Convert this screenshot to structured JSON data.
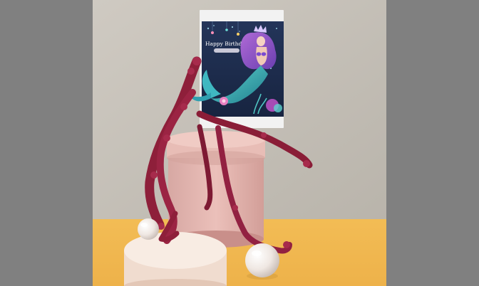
{
  "image": {
    "description_colors": {
      "letterbox": "#808080",
      "wall": "#c8c3bb",
      "floor": "#f0b84d",
      "box": "#e6b9b3",
      "flowers": "#8e1f3a",
      "card_background": "#1c2b4a"
    }
  },
  "card": {
    "title": "Happy Birthday"
  }
}
